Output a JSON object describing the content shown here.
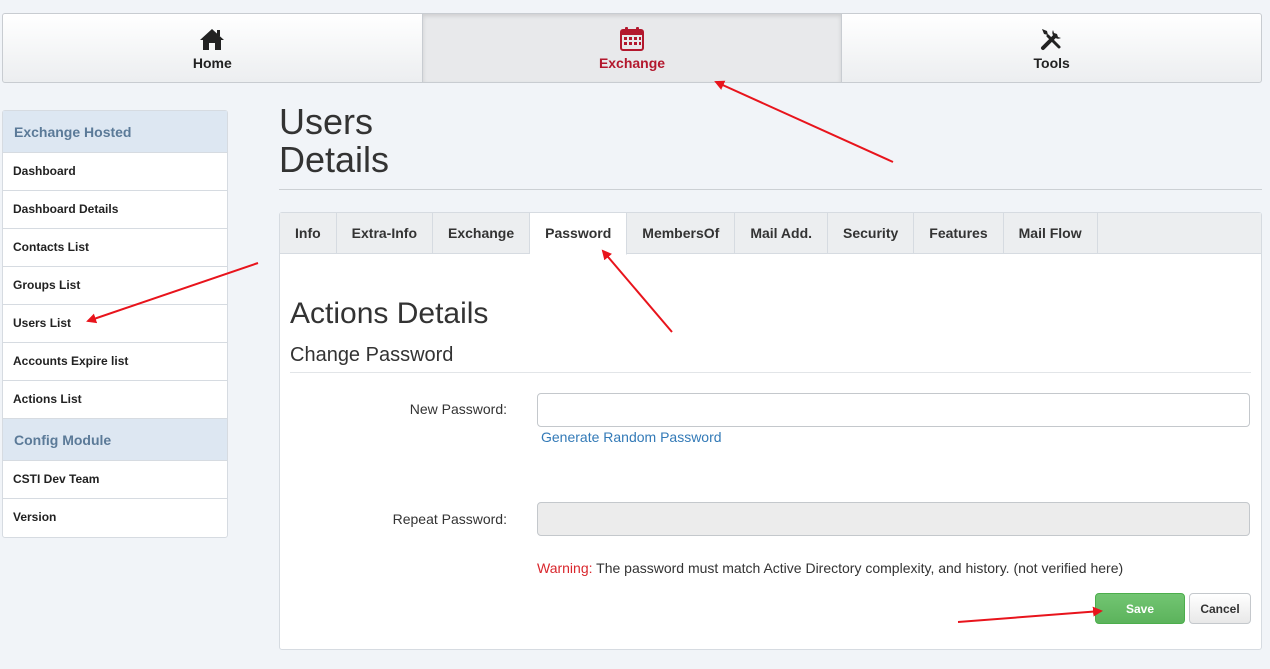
{
  "topnav": {
    "items": [
      {
        "label": "Home",
        "icon": "home-icon"
      },
      {
        "label": "Exchange",
        "icon": "calendar-icon",
        "active": true
      },
      {
        "label": "Tools",
        "icon": "wrench-screwdriver-icon"
      }
    ]
  },
  "sidebar": {
    "groups": [
      {
        "header": "Exchange Hosted",
        "items": [
          "Dashboard",
          "Dashboard Details",
          "Contacts List",
          "Groups List",
          "Users List",
          "Accounts Expire list",
          "Actions List"
        ]
      },
      {
        "header": "Config Module",
        "items": [
          "CSTI Dev Team",
          "Version"
        ]
      }
    ]
  },
  "page": {
    "title_line1": "Users",
    "title_line2": "Details"
  },
  "tabs": [
    "Info",
    "Extra-Info",
    "Exchange",
    "Password",
    "MembersOf",
    "Mail Add.",
    "Security",
    "Features",
    "Mail Flow"
  ],
  "active_tab": "Password",
  "form": {
    "section_title": "Actions Details",
    "subsection_title": "Change Password",
    "new_password_label": "New Password:",
    "new_password_value": "",
    "generate_link": "Generate Random Password",
    "repeat_password_label": "Repeat Password:",
    "repeat_password_value": "",
    "warning_label": "Warning:",
    "warning_text": " The password must match Active Directory complexity, and history. (not verified here)",
    "save_label": "Save",
    "cancel_label": "Cancel"
  },
  "colors": {
    "accent_active": "#b3182d",
    "sidebar_header_bg": "#dde7f2",
    "save_green": "#5cb35c",
    "link_blue": "#337ab7",
    "warning_red": "#d9262c",
    "annotation_arrow": "#e8141c"
  }
}
